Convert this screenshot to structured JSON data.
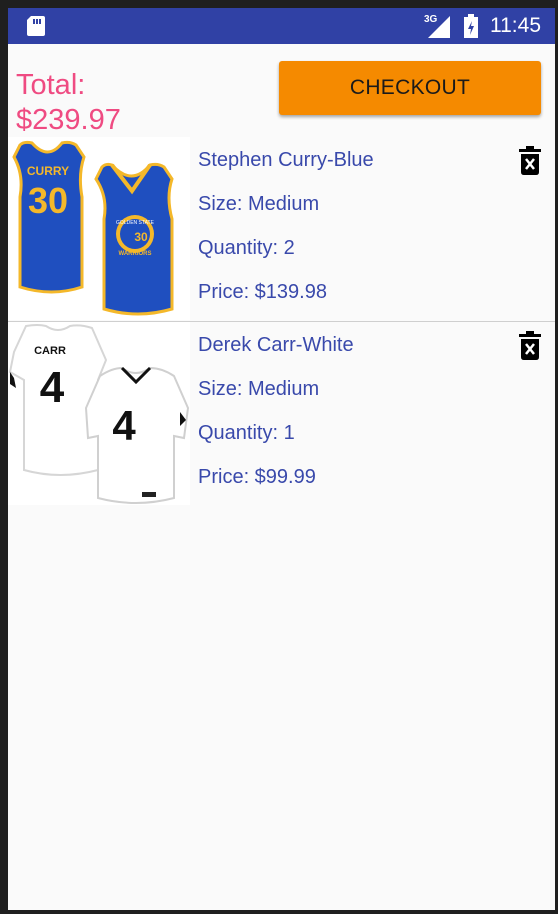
{
  "status_bar": {
    "network_type": "3G",
    "time": "11:45"
  },
  "cart": {
    "total_label": "Total:\n$239.97",
    "checkout_label": "CHECKOUT",
    "items": [
      {
        "name": "Stephen Curry-Blue",
        "size": "Size: Medium",
        "quantity": "Quantity: 2",
        "price": "Price: $139.98",
        "jersey_name": "CURRY",
        "jersey_number": "30",
        "jersey_back_text": "GOLDEN STATE",
        "jersey_front_text": "WARRIORS"
      },
      {
        "name": "Derek Carr-White",
        "size": "Size: Medium",
        "quantity": "Quantity: 1",
        "price": "Price: $99.99",
        "jersey_name": "CARR",
        "jersey_number": "4"
      }
    ]
  },
  "colors": {
    "status_bar": "#3041a5",
    "total_text": "#ef4b82",
    "checkout_button": "#f58a00",
    "item_text": "#3949ab",
    "jersey_blue": "#1f4fbf",
    "jersey_gold": "#f4b82a"
  },
  "icons": {
    "sd_card": "sd-card-icon",
    "signal": "signal-icon",
    "battery": "battery-charging-icon",
    "delete": "delete-icon"
  }
}
